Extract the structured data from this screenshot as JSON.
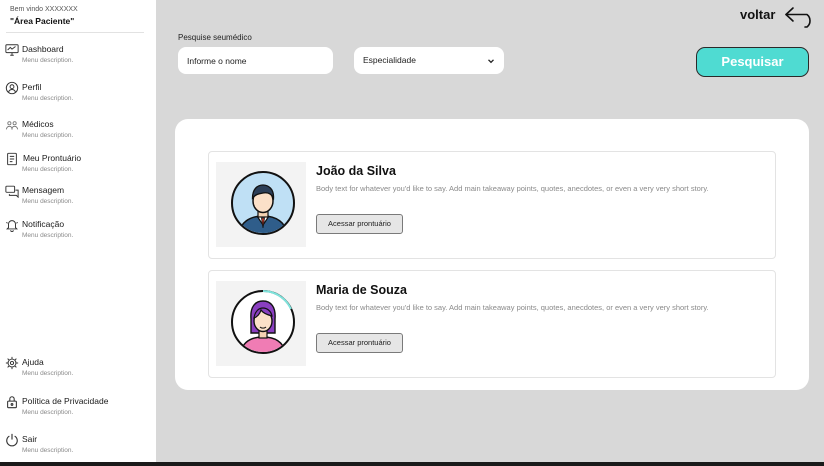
{
  "sidebar": {
    "welcome": "Bem vindo XXXXXXX",
    "area": "\"Área Paciente\"",
    "items": [
      {
        "label": "Dashboard",
        "desc": "Menu description.",
        "icon": "dashboard-icon"
      },
      {
        "label": "Perfil",
        "desc": "Menu description.",
        "icon": "user-icon"
      },
      {
        "label": "Médicos",
        "desc": "Menu description.",
        "icon": "doctors-icon"
      },
      {
        "label": "Meu Prontuário",
        "desc": "Menu description.",
        "icon": "medical-record-icon"
      },
      {
        "label": "Mensagem",
        "desc": "Menu description.",
        "icon": "message-icon"
      },
      {
        "label": "Notificação",
        "desc": "Menu description.",
        "icon": "bell-icon"
      }
    ],
    "bottom_items": [
      {
        "label": "Ajuda",
        "desc": "Menu description.",
        "icon": "help-icon"
      },
      {
        "label": "Política de Privacidade",
        "desc": "Menu description.",
        "icon": "lock-icon"
      },
      {
        "label": "Sair",
        "desc": "Menu description.",
        "icon": "power-icon"
      }
    ]
  },
  "header": {
    "back_label": "voltar",
    "back_icon": "back-arrow-icon"
  },
  "search": {
    "label": "Pesquise seumédico",
    "name_placeholder": "Informe o nome",
    "specialty_value": "Especialidade",
    "button_label": "Pesquisar"
  },
  "results": [
    {
      "name": "João da Silva",
      "body": "Body text for whatever you'd like to say. Add main takeaway points, quotes, anecdotes, or even a very very short story.",
      "button": "Acessar prontuário",
      "avatar": "male-doctor-avatar"
    },
    {
      "name": "Maria de Souza",
      "body": "Body text for whatever you'd like to say. Add main takeaway points, quotes, anecdotes, or even a very very short story.",
      "button": "Acessar prontuário",
      "avatar": "female-doctor-avatar"
    }
  ],
  "colors": {
    "background": "#d8d8d8",
    "accent": "#4fdbd2",
    "panel": "#ffffff"
  }
}
